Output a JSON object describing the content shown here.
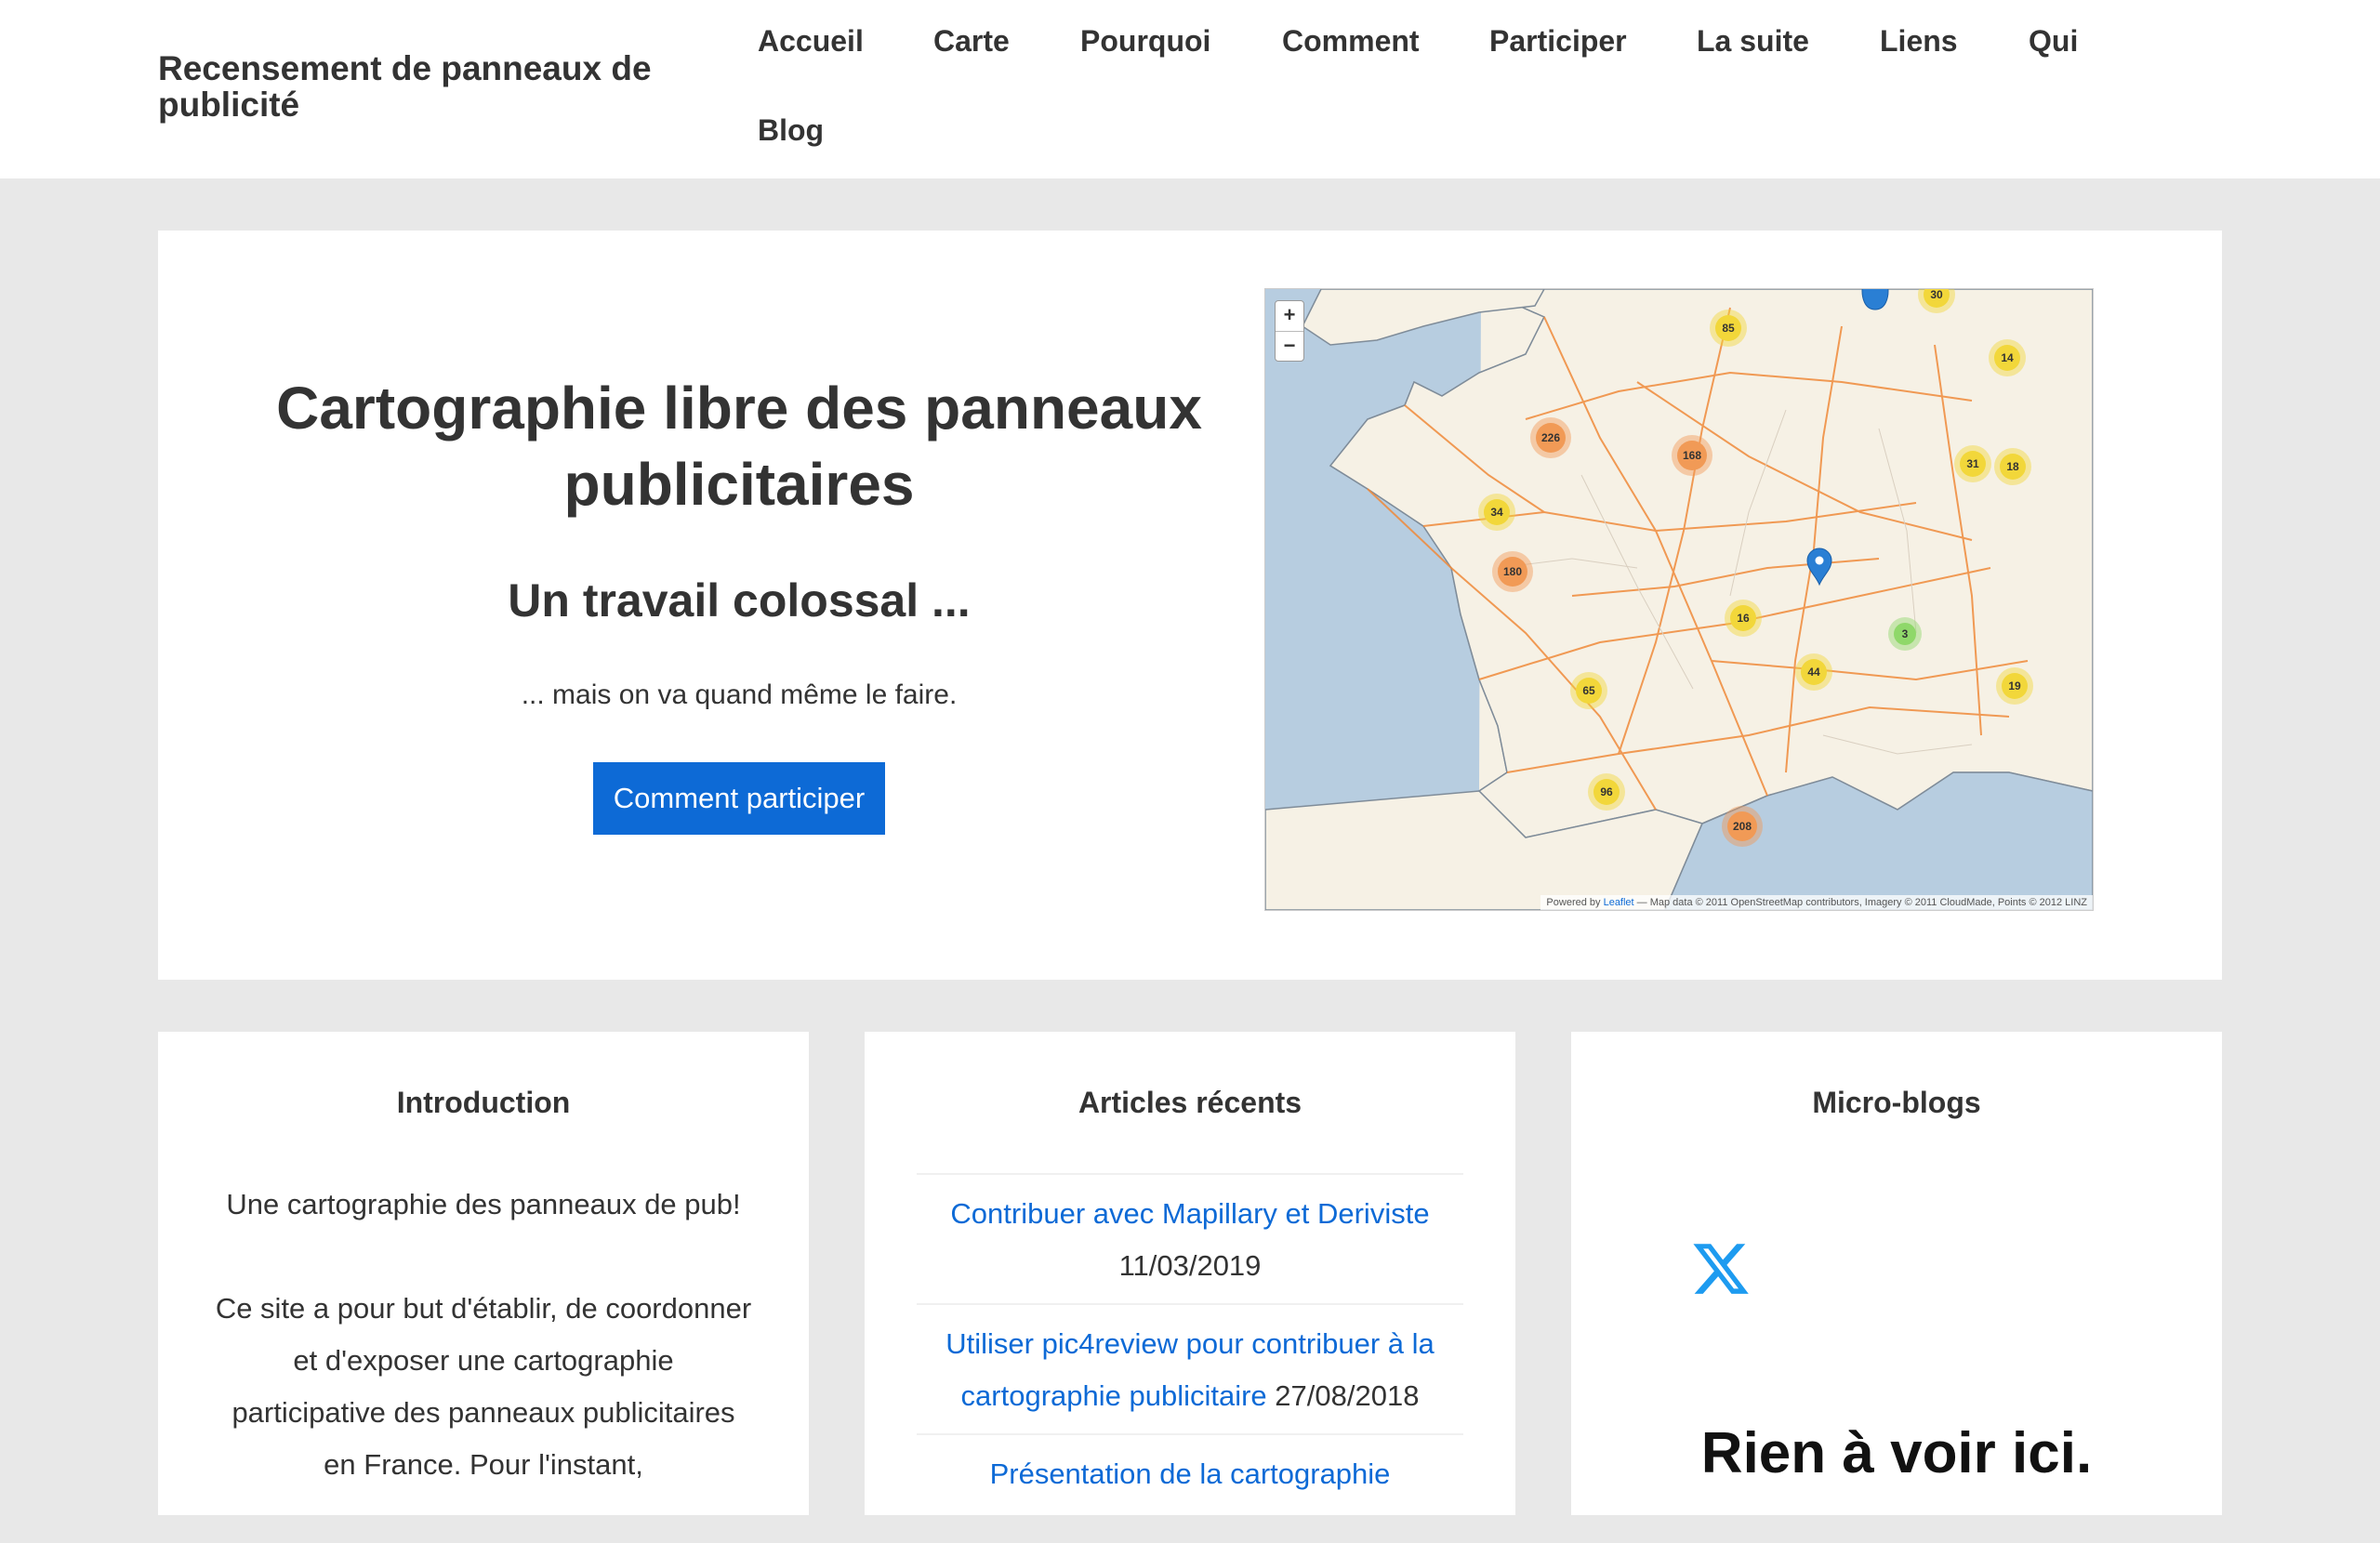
{
  "header": {
    "site_title": "Recensement de panneaux de publicité",
    "nav": [
      {
        "label": "Accueil"
      },
      {
        "label": "Carte"
      },
      {
        "label": "Pourquoi"
      },
      {
        "label": "Comment"
      },
      {
        "label": "Participer"
      },
      {
        "label": "La suite"
      },
      {
        "label": "Liens"
      },
      {
        "label": "Qui"
      },
      {
        "label": "Blog"
      }
    ]
  },
  "hero": {
    "title": "Cartographie libre des panneaux publicitaires",
    "subtitle": "Un travail colossal ...",
    "text": "... mais on va quand même le faire.",
    "button_label": "Comment participer"
  },
  "map": {
    "zoom_in": "+",
    "zoom_out": "−",
    "attribution_prefix": "Powered by",
    "attribution_link": "Leaflet",
    "attribution_rest": " — Map data © 2011 OpenStreetMap contributors, Imagery © 2011 CloudMade, Points © 2012 LINZ",
    "cluster_colors": {
      "small": "#f2d73a",
      "medium": "#f19a56",
      "tiny": "#8fd86a"
    },
    "pin_color": "#2a7fd4",
    "clusters": [
      {
        "label": "85",
        "level": "small"
      },
      {
        "label": "30",
        "level": "small"
      },
      {
        "label": "14",
        "level": "small"
      },
      {
        "label": "226",
        "level": "medium"
      },
      {
        "label": "168",
        "level": "medium"
      },
      {
        "label": "31",
        "level": "small"
      },
      {
        "label": "18",
        "level": "small"
      },
      {
        "label": "34",
        "level": "small"
      },
      {
        "label": "180",
        "level": "medium"
      },
      {
        "label": "16",
        "level": "small"
      },
      {
        "label": "3",
        "level": "tiny"
      },
      {
        "label": "44",
        "level": "small"
      },
      {
        "label": "19",
        "level": "small"
      },
      {
        "label": "65",
        "level": "small"
      },
      {
        "label": "96",
        "level": "small"
      },
      {
        "label": "208",
        "level": "medium"
      }
    ]
  },
  "widgets": {
    "intro": {
      "title": "Introduction",
      "p1": "Une cartographie des panneaux de pub!",
      "p2": "Ce site a pour but d'établir, de coordonner et d'exposer une cartographie participative des panneaux publicitaires en France. Pour l'instant,"
    },
    "articles": {
      "title": "Articles récents",
      "items": [
        {
          "title": "Contribuer avec Mapillary et Deriviste",
          "date": "11/03/2019"
        },
        {
          "title": "Utiliser pic4review pour contribuer à la cartographie publicitaire",
          "date": "27/08/2018"
        },
        {
          "title": "Présentation de la cartographie",
          "date": ""
        }
      ]
    },
    "micro": {
      "title": "Micro-blogs",
      "icon": "x-logo-icon",
      "icon_color": "#1d9bf0",
      "empty_text": "Rien à voir ici."
    }
  }
}
